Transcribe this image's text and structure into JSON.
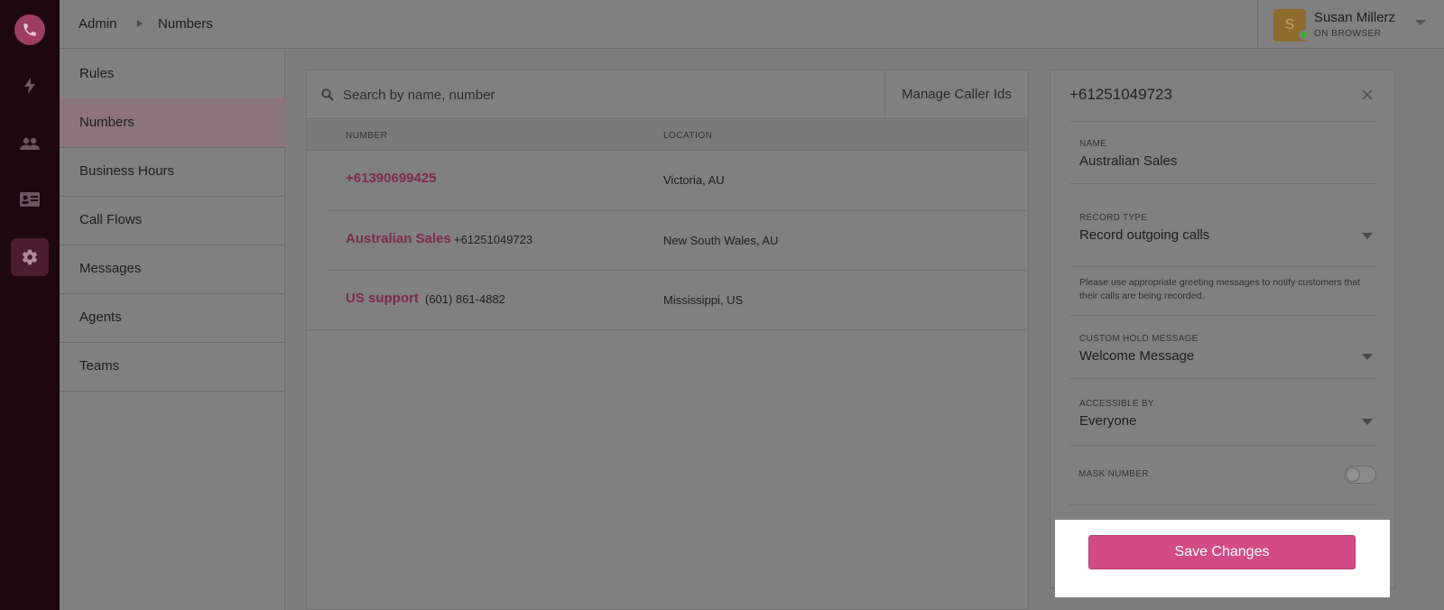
{
  "breadcrumb": {
    "root": "Admin",
    "current": "Numbers"
  },
  "user": {
    "initial": "S",
    "name": "Susan Millerz",
    "status": "ON BROWSER"
  },
  "sidebar": {
    "items": [
      {
        "label": "Rules"
      },
      {
        "label": "Numbers"
      },
      {
        "label": "Business Hours"
      },
      {
        "label": "Call Flows"
      },
      {
        "label": "Messages"
      },
      {
        "label": "Agents"
      },
      {
        "label": "Teams"
      }
    ]
  },
  "search": {
    "placeholder": "Search by name, number"
  },
  "manage_caller_ids": "Manage Caller Ids",
  "table": {
    "columns": [
      "NUMBER",
      "LOCATION"
    ],
    "rows": [
      {
        "name": "+61390699425",
        "number": "",
        "location": "Victoria, AU"
      },
      {
        "name": "Australian Sales",
        "number": "+61251049723",
        "location": "New South Wales, AU"
      },
      {
        "name": "US support",
        "number": "(601) 861-4882",
        "location": "Mississippi, US"
      }
    ]
  },
  "detail": {
    "title": "+61251049723",
    "name_label": "NAME",
    "name_value": "Australian Sales",
    "record_type_label": "RECORD TYPE",
    "record_type_value": "Record outgoing calls",
    "hint": "Please use appropriate greeting messages to notify customers that their calls are being recorded.",
    "hold_label": "CUSTOM HOLD MESSAGE",
    "hold_value": "Welcome Message",
    "access_label": "ACCESSIBLE BY",
    "access_value": "Everyone",
    "mask_label": "MASK NUMBER",
    "mask_on": false,
    "save_label": "Save Changes"
  },
  "colors": {
    "accent": "#d24b86",
    "brand_rail": "#1e080f"
  }
}
